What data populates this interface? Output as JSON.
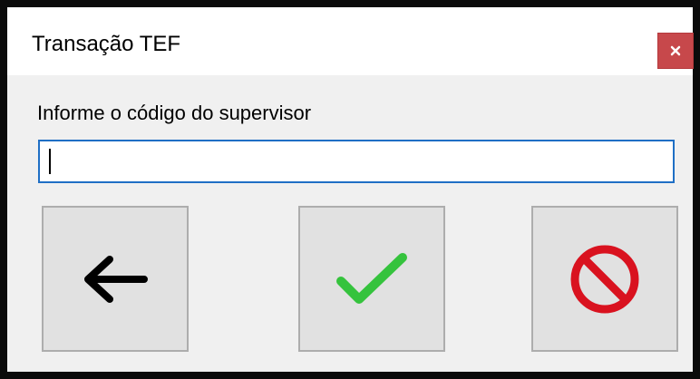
{
  "window": {
    "title": "Transação TEF",
    "close_icon": "close-icon",
    "close_color": "#c7484b"
  },
  "form": {
    "prompt": "Informe o código do supervisor",
    "supervisor_code_value": "",
    "supervisor_code_placeholder": ""
  },
  "buttons": {
    "back": {
      "icon": "arrow-left-icon",
      "color": "#000000"
    },
    "confirm": {
      "icon": "checkmark-icon",
      "color": "#35c33d"
    },
    "cancel": {
      "icon": "prohibited-icon",
      "color": "#d9121f"
    }
  }
}
